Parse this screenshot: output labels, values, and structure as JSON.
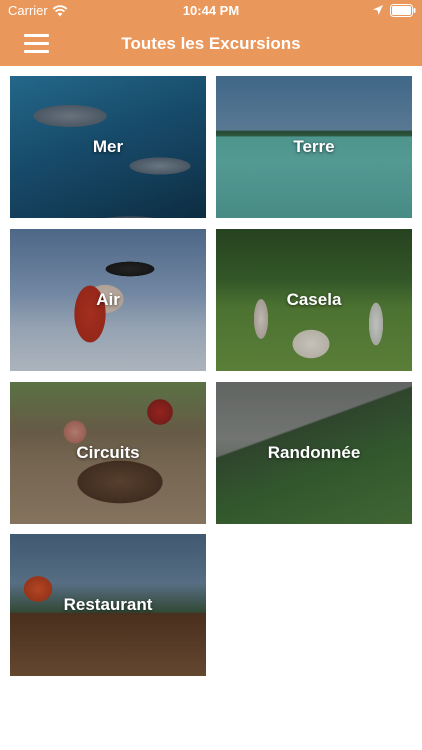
{
  "status_bar": {
    "carrier": "Carrier",
    "time": "10:44 PM"
  },
  "nav": {
    "title": "Toutes les Excursions",
    "menu_icon": "hamburger-menu-icon"
  },
  "colors": {
    "brand": "#e9975a",
    "background": "#ffffff",
    "tile_text": "#ffffff"
  },
  "categories": [
    {
      "label": "Mer"
    },
    {
      "label": "Terre"
    },
    {
      "label": "Air"
    },
    {
      "label": "Casela"
    },
    {
      "label": "Circuits"
    },
    {
      "label": "Randonnée"
    },
    {
      "label": "Restaurant"
    }
  ]
}
